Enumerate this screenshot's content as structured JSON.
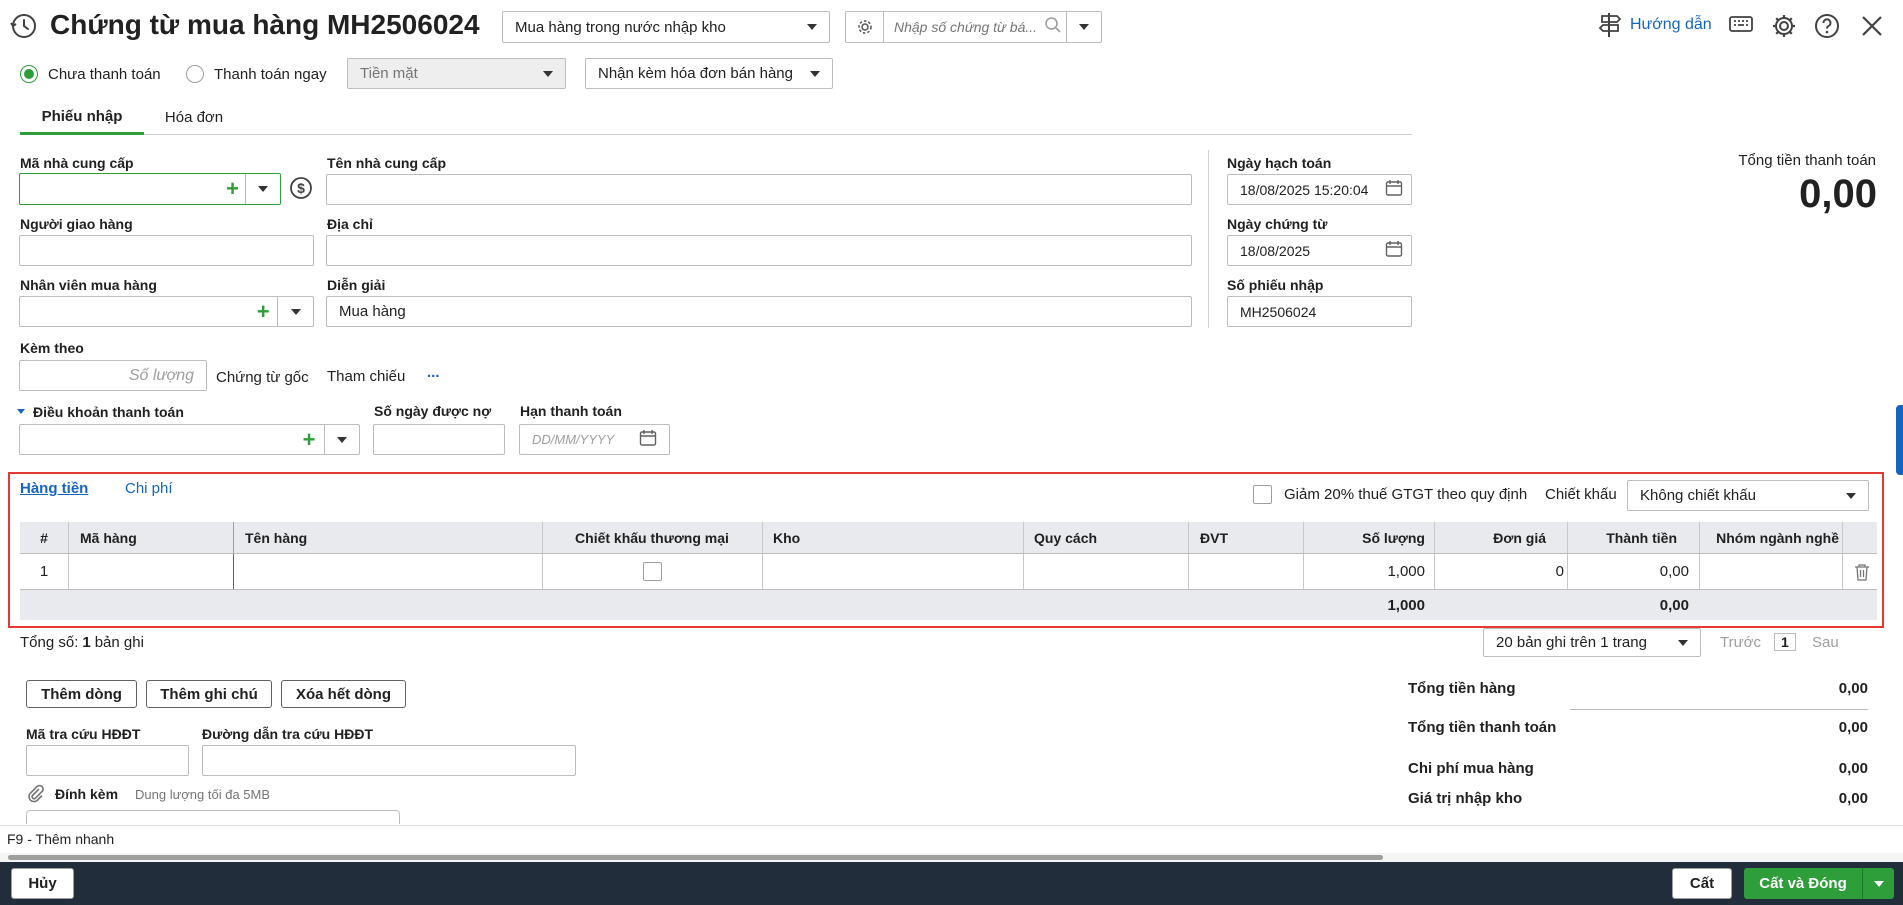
{
  "header": {
    "title": "Chứng từ mua hàng MH2506024",
    "type_select": "Mua hàng trong nước nhập kho",
    "search_placeholder": "Nhập số chứng từ bá...",
    "help_label": "Hướng dẫn"
  },
  "payment": {
    "option_unpaid": "Chưa thanh toán",
    "option_paid": "Thanh toán ngay",
    "method": "Tiền mặt",
    "invoice_select": "Nhận kèm hóa đơn bán hàng",
    "selected": "unpaid"
  },
  "tabs": [
    {
      "label": "Phiếu nhập",
      "active": true
    },
    {
      "label": "Hóa đơn",
      "active": false
    }
  ],
  "form": {
    "supplier_code_label": "Mã nhà cung cấp",
    "supplier_code": "",
    "supplier_name_label": "Tên nhà cung cấp",
    "supplier_name": "",
    "deliverer_label": "Người giao hàng",
    "deliverer": "",
    "address_label": "Địa chỉ",
    "address": "",
    "buyer_label": "Nhân viên mua hàng",
    "buyer": "",
    "description_label": "Diễn giải",
    "description": "Mua hàng",
    "attach_label": "Kèm theo",
    "attach_placeholder": "Số lượng",
    "original_doc": "Chứng từ gốc",
    "reference": "Tham chiếu",
    "reference_more": "...",
    "payment_terms_label": "Điều khoản thanh toán",
    "payment_terms": "",
    "credit_days_label": "Số ngày được nợ",
    "credit_days": "",
    "due_date_label": "Hạn thanh toán",
    "due_date_placeholder": "DD/MM/YYYY"
  },
  "dates": {
    "posting_date_label": "Ngày hạch toán",
    "posting_date": "18/08/2025 15:20:04",
    "doc_date_label": "Ngày chứng từ",
    "doc_date": "18/08/2025",
    "receipt_no_label": "Số phiếu nhập",
    "receipt_no": "MH2506024"
  },
  "total": {
    "label": "Tổng tiền thanh toán",
    "value": "0,00"
  },
  "grid": {
    "tabs": [
      "Hàng tiền",
      "Chi phí"
    ],
    "vat_reduction": "Giảm 20% thuế GTGT theo quy định",
    "discount_label": "Chiết khấu",
    "discount_value": "Không chiết khấu",
    "columns": [
      "#",
      "Mã hàng",
      "Tên hàng",
      "Chiết khấu thương mại",
      "Kho",
      "Quy cách",
      "ĐVT",
      "Số lượng",
      "Đơn giá",
      "Thành tiền",
      "Nhóm ngành nghề"
    ],
    "rows": [
      {
        "no": "1",
        "code": "",
        "name": "",
        "trade_discount": false,
        "warehouse": "",
        "spec": "",
        "unit": "",
        "qty": "1,000",
        "price": "0",
        "amount": "0,00",
        "industry": ""
      }
    ],
    "totals": {
      "qty": "1,000",
      "amount": "0,00"
    }
  },
  "footer_grid": {
    "count_prefix": "Tổng số:",
    "count": "1",
    "count_suffix": "bản ghi",
    "page_size": "20 bản ghi trên 1 trang",
    "prev": "Trước",
    "page": "1",
    "next": "Sau"
  },
  "actions": {
    "add_row": "Thêm dòng",
    "add_note": "Thêm ghi chú",
    "delete_rows": "Xóa hết dòng"
  },
  "einvoice": {
    "lookup_code_label": "Mã tra cứu HĐĐT",
    "lookup_url_label": "Đường dẫn tra cứu HĐĐT",
    "attachment_label": "Đính kèm",
    "attachment_hint": "Dung lượng tối đa 5MB"
  },
  "summary": [
    {
      "label": "Tổng tiền hàng",
      "value": "0,00"
    },
    {
      "label": "Tổng tiền thanh toán",
      "value": "0,00"
    },
    {
      "label": "Chi phí mua hàng",
      "value": "0,00"
    },
    {
      "label": "Giá trị nhập kho",
      "value": "0,00"
    }
  ],
  "shortcut_hint": "F9 - Thêm nhanh",
  "bottom": {
    "cancel": "Hủy",
    "save": "Cất",
    "save_close": "Cất và Đóng"
  }
}
